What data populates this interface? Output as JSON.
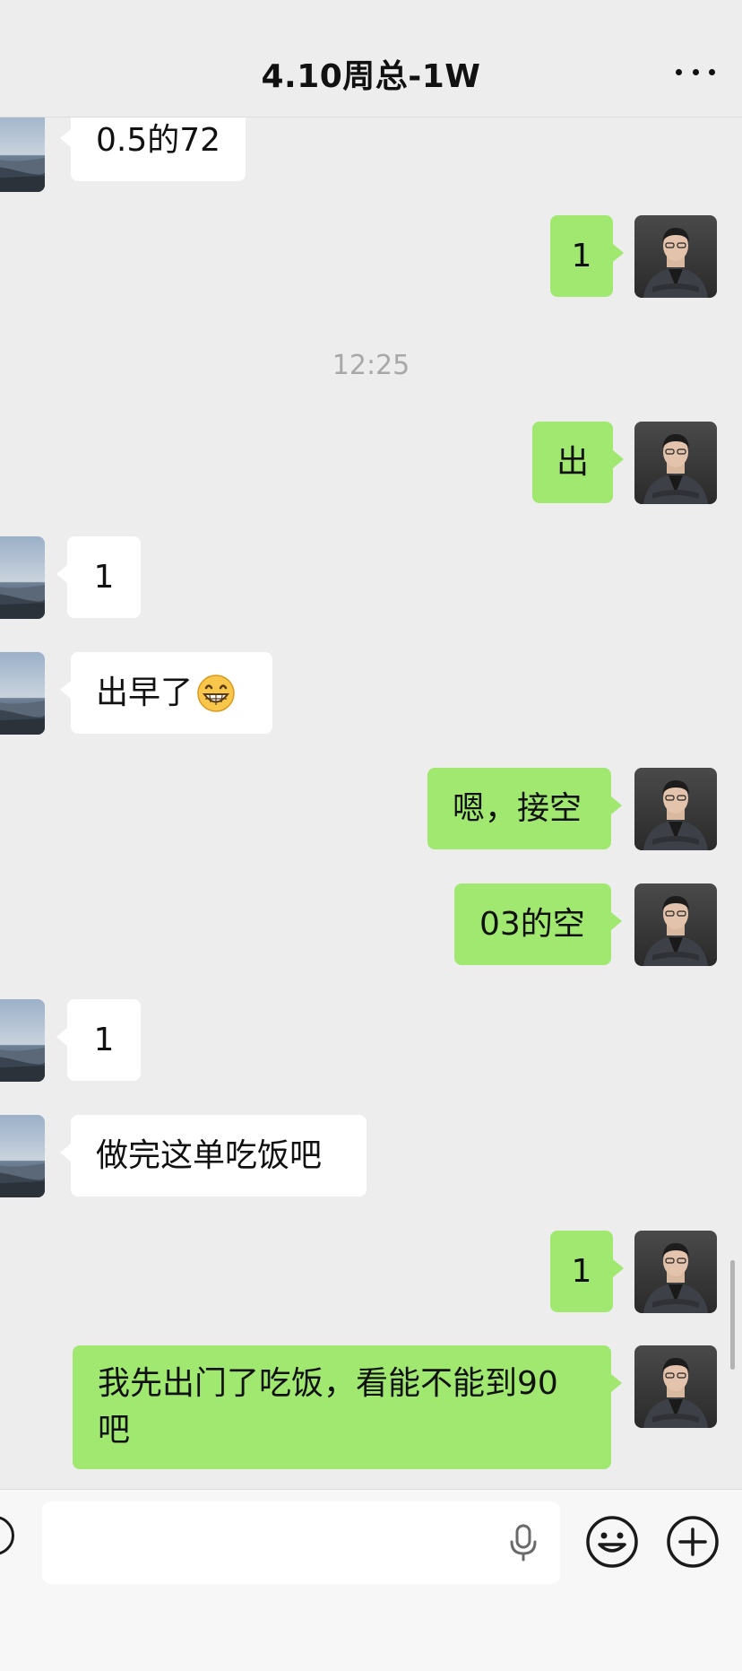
{
  "header": {
    "title": "4.10周总-1W",
    "more_icon": "more-dots-icon"
  },
  "timestamp": "12:25",
  "messages": [
    {
      "id": 0,
      "side": "in",
      "text": "0.5的72"
    },
    {
      "id": 1,
      "side": "out",
      "text": "1"
    },
    {
      "id": 2,
      "side": "out",
      "text": "出"
    },
    {
      "id": 3,
      "side": "in",
      "text": "1"
    },
    {
      "id": 4,
      "side": "in",
      "text": "出早了",
      "emoji": "grinning-face-icon"
    },
    {
      "id": 5,
      "side": "out",
      "text": "嗯，接空"
    },
    {
      "id": 6,
      "side": "out",
      "text": "03的空"
    },
    {
      "id": 7,
      "side": "in",
      "text": "1"
    },
    {
      "id": 8,
      "side": "in",
      "text": "做完这单吃饭吧"
    },
    {
      "id": 9,
      "side": "out",
      "text": "1"
    },
    {
      "id": 10,
      "side": "out",
      "text": "我先出门了吃饭，看能不能到90吧"
    }
  ],
  "input_bar": {
    "value": "",
    "placeholder": "",
    "icons": [
      "voice-icon",
      "microphone-icon",
      "emoji-icon",
      "plus-icon"
    ]
  },
  "colors": {
    "background": "#ededed",
    "incoming_bubble": "#ffffff",
    "outgoing_bubble": "#a0e870",
    "timestamp_text": "#a8a8a8"
  }
}
